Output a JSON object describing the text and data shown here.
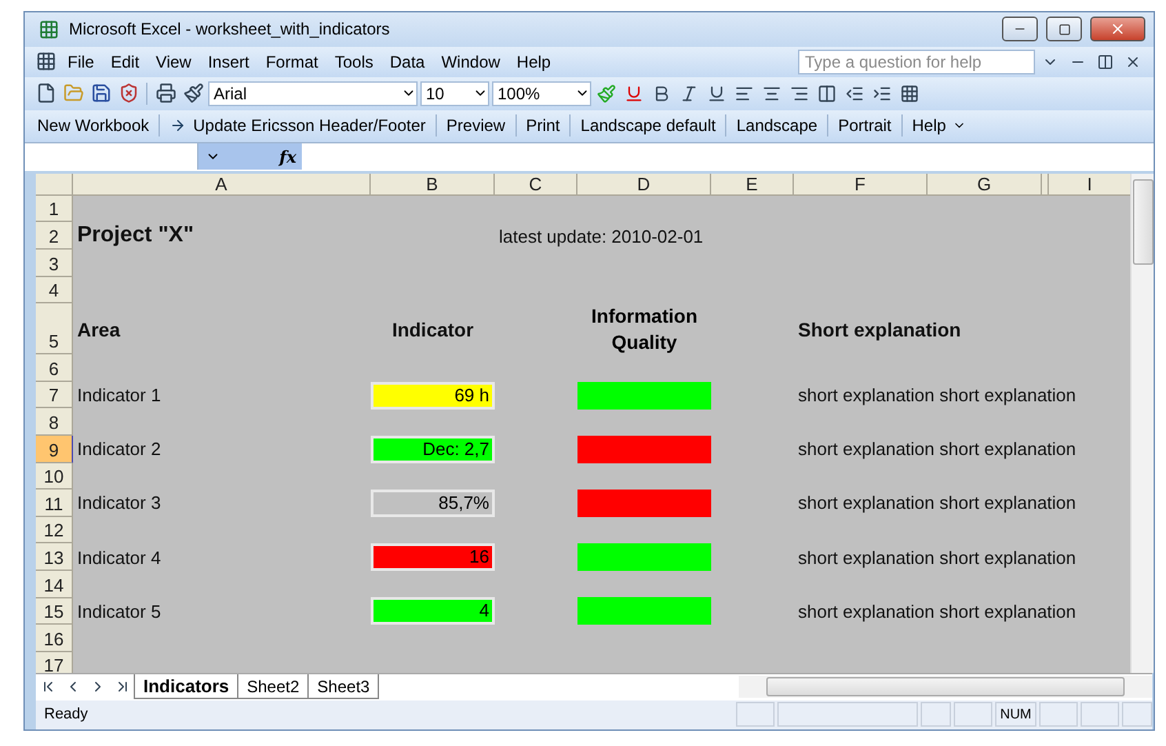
{
  "window": {
    "title": "Microsoft Excel - worksheet_with_indicators"
  },
  "menu": [
    "File",
    "Edit",
    "View",
    "Insert",
    "Format",
    "Tools",
    "Data",
    "Window",
    "Help"
  ],
  "help_search": {
    "placeholder": "Type a question for help"
  },
  "formatting": {
    "font": "Arial",
    "size": "10",
    "zoom": "100%"
  },
  "custom_toolbar": [
    {
      "label": "New Workbook",
      "kind": "text"
    },
    {
      "label": "Update Ericsson Header/Footer",
      "kind": "arrow"
    },
    {
      "label": "Preview",
      "kind": "text"
    },
    {
      "label": "Print",
      "kind": "text"
    },
    {
      "label": "Landscape default",
      "kind": "text"
    },
    {
      "label": "Landscape",
      "kind": "text"
    },
    {
      "label": "Portrait",
      "kind": "text"
    },
    {
      "label": "Help",
      "kind": "menu"
    }
  ],
  "formula_bar": {
    "function_label": "fx"
  },
  "columns": [
    "A",
    "B",
    "C",
    "D",
    "E",
    "F",
    "G",
    "I"
  ],
  "rows": [
    {
      "number": "1",
      "selected": false,
      "kind": "blank"
    },
    {
      "number": "2",
      "selected": false,
      "kind": "title",
      "title": "Project \"X\"",
      "update": "latest update: 2010-02-01"
    },
    {
      "number": "3",
      "selected": false,
      "kind": "blank"
    },
    {
      "number": "4",
      "selected": false,
      "kind": "blank"
    },
    {
      "number": "5",
      "selected": false,
      "kind": "header",
      "area": "Area",
      "indicator": "Indicator",
      "quality": "Information Quality",
      "explanation": "Short explanation"
    },
    {
      "number": "6",
      "selected": false,
      "kind": "blank"
    },
    {
      "number": "7",
      "selected": false,
      "kind": "indicator",
      "area": "Indicator 1",
      "value": {
        "text": "69 h",
        "color": "#ffff00"
      },
      "quality": {
        "color": "#00ff00"
      },
      "explanation": "short explanation short explanation"
    },
    {
      "number": "8",
      "selected": false,
      "kind": "blank"
    },
    {
      "number": "9",
      "selected": true,
      "kind": "indicator",
      "area": "Indicator 2",
      "value": {
        "text": "Dec: 2,7",
        "color": "#00ff00"
      },
      "quality": {
        "color": "#ff0000"
      },
      "explanation": "short explanation short explanation"
    },
    {
      "number": "10",
      "selected": false,
      "kind": "blank"
    },
    {
      "number": "11",
      "selected": false,
      "kind": "indicator",
      "area": "Indicator 3",
      "value": {
        "text": "85,7%",
        "color": "#c0c0c0"
      },
      "quality": {
        "color": "#ff0000"
      },
      "explanation": "short explanation short explanation"
    },
    {
      "number": "12",
      "selected": false,
      "kind": "blank"
    },
    {
      "number": "13",
      "selected": false,
      "kind": "indicator",
      "area": "Indicator 4",
      "value": {
        "text": "16",
        "color": "#ff0000"
      },
      "quality": {
        "color": "#00ff00"
      },
      "explanation": "short explanation short explanation"
    },
    {
      "number": "14",
      "selected": false,
      "kind": "blank"
    },
    {
      "number": "15",
      "selected": false,
      "kind": "indicator",
      "area": "Indicator 5",
      "value": {
        "text": "4",
        "color": "#00ff00"
      },
      "quality": {
        "color": "#00ff00"
      },
      "explanation": "short explanation short explanation"
    },
    {
      "number": "16",
      "selected": false,
      "kind": "blank"
    },
    {
      "number": "17",
      "selected": false,
      "kind": "blank"
    }
  ],
  "sheet_tabs": [
    {
      "label": "Indicators",
      "selected": true
    },
    {
      "label": "Sheet2",
      "selected": false
    },
    {
      "label": "Sheet3",
      "selected": false
    }
  ],
  "status_bar": {
    "text": "Ready",
    "num": "NUM"
  }
}
